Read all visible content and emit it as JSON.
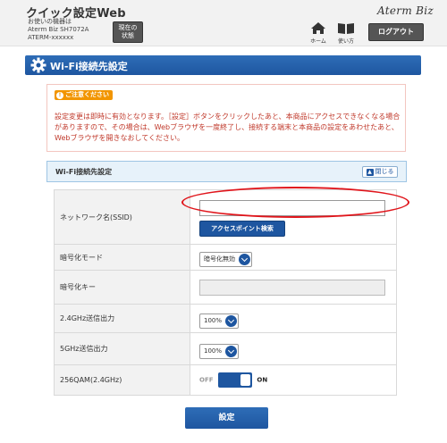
{
  "header": {
    "app_title": "クイック設定Web",
    "device_info": [
      "お使いの機器は",
      "Aterm Biz SH7072A",
      "ATERM-xxxxxx"
    ],
    "status_button": [
      "現在の",
      "状態"
    ],
    "brand": "Aterm Biz",
    "home_label": "ホーム",
    "help_label": "使い方",
    "logout_label": "ログアウト"
  },
  "page": {
    "title": "Wi-Fi接続先設定"
  },
  "notice": {
    "badge": "ご注意ください",
    "text": "設定変更は即時に有効となります。［設定］ボタンをクリックしたあと、本商品にアクセスできなくなる場合がありますので、その場合は、Webブラウザを一度終了し、接続する端末と本商品の設定をあわせたあと、Webブラウザを開きなおしてください。"
  },
  "section": {
    "title": "Wi-Fi接続先設定",
    "collapse_label": "閉じる"
  },
  "form": {
    "ssid": {
      "label": "ネットワーク名(SSID)",
      "value": "",
      "scan_button": "アクセスポイント検索"
    },
    "encryption_mode": {
      "label": "暗号化モード",
      "value": "暗号化無効"
    },
    "encryption_key": {
      "label": "暗号化キー",
      "value": ""
    },
    "power_24": {
      "label": "2.4GHz送信出力",
      "value": "100%"
    },
    "power_5": {
      "label": "5GHz送信出力",
      "value": "100%"
    },
    "qam256": {
      "label": "256QAM(2.4GHz)",
      "off_label": "OFF",
      "on_label": "ON",
      "state": "ON"
    }
  },
  "actions": {
    "apply_label": "設定"
  },
  "icons": {
    "gear": "gear-icon",
    "home": "home-icon",
    "help": "book-icon",
    "notice": "exclamation-icon",
    "collapse": "chevron-up-icon",
    "select": "chevron-down-icon"
  },
  "colors": {
    "primary": "#1e56a0",
    "notice_text": "#c0392b",
    "badge": "#f29500",
    "annotation": "#e0151b"
  }
}
